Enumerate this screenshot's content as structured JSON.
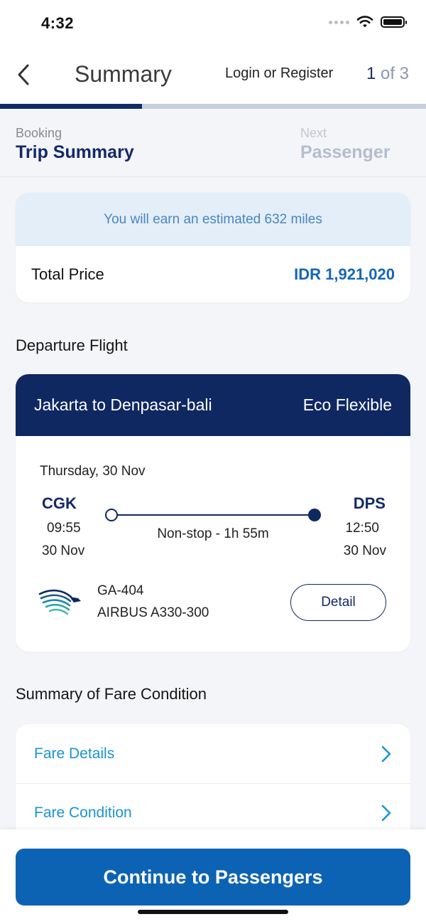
{
  "status_bar": {
    "time": "4:32"
  },
  "header": {
    "title": "Summary",
    "login_label": "Login or Register",
    "step_current": "1",
    "step_total": "of 3"
  },
  "progress": {
    "fraction": 0.333
  },
  "steps": {
    "current_caption": "Booking",
    "current_label": "Trip Summary",
    "next_caption": "Next",
    "next_label": "Passenger"
  },
  "price_card": {
    "miles_text": "You will earn an estimated 632 miles",
    "total_label": "Total Price",
    "total_value": "IDR 1,921,020"
  },
  "departure": {
    "section_title": "Departure Flight",
    "route": "Jakarta to Denpasar-bali",
    "fare_class": "Eco Flexible",
    "date": "Thursday, 30 Nov",
    "origin": {
      "code": "CGK",
      "time": "09:55",
      "date": "30 Nov"
    },
    "destination": {
      "code": "DPS",
      "time": "12:50",
      "date": "30 Nov"
    },
    "duration": "Non-stop - 1h 55m",
    "flight_number": "GA-404",
    "aircraft": "AIRBUS A330-300",
    "detail_label": "Detail"
  },
  "fare_summary": {
    "section_title": "Summary of Fare Condition",
    "items": [
      {
        "label": "Fare Details"
      },
      {
        "label": "Fare Condition"
      }
    ]
  },
  "cta": {
    "label": "Continue to Passengers"
  },
  "colors": {
    "navy": "#0f2862",
    "primary_blue": "#0d63b3",
    "link_blue": "#1a94d4"
  }
}
